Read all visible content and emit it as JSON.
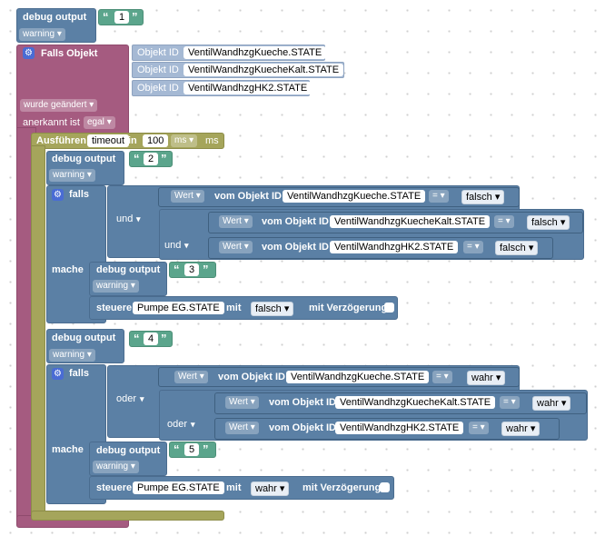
{
  "labels": {
    "debug_output": "debug output",
    "warning": "warning",
    "falls_objekt": "Falls Objekt",
    "objekt_id": "Objekt ID",
    "wurde_geaendert": "wurde geändert",
    "anerkannt_ist": "anerkannt ist",
    "egal": "egal",
    "ausfuehren": "Ausführen",
    "timeout": "timeout",
    "in": "in",
    "timeout_value": "100",
    "ms": "ms",
    "falls": "falls",
    "mache": "mache",
    "und": "und",
    "oder": "oder",
    "wert": "Wert",
    "vom_objekt_id": "vom Objekt ID",
    "eq": "=",
    "falsch": "falsch",
    "wahr": "wahr",
    "steuere": "steuere",
    "mit": "mit",
    "mit_verzoegerung": "mit Verzögerung",
    "open_quote": "“",
    "close_quote": "”",
    "dropdown_arrow": "▾"
  },
  "debug_values": [
    "1",
    "2",
    "3",
    "4",
    "5"
  ],
  "trigger_objects": [
    "VentilWandhzgKueche.STATE",
    "VentilWandhzgKuecheKalt.STATE",
    "VentilWandhzgHK2.STATE"
  ],
  "condition_objects": [
    "VentilWandhzgKueche.STATE",
    "VentilWandhzgKuecheKalt.STATE",
    "VentilWandhzgHK2.STATE"
  ],
  "target_object": "Pumpe EG.STATE",
  "icons": {
    "gear": "gear-icon",
    "checkbox": "checkbox-icon"
  },
  "colors": {
    "debug": "#5b80a5",
    "trigger": "#a55b80",
    "timer": "#a5a55b",
    "text": "#5ba58c",
    "objid": "#a5b9d4"
  }
}
